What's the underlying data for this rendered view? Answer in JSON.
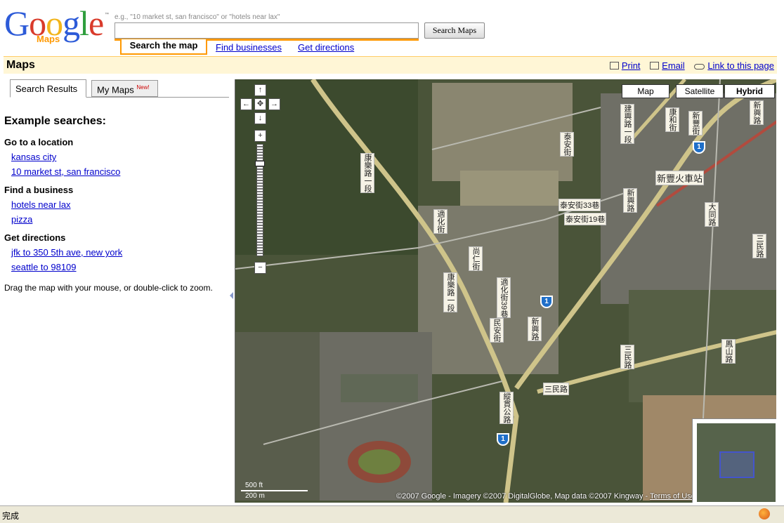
{
  "logo": {
    "text": "Google",
    "product": "Maps",
    "tm": "™"
  },
  "search": {
    "hint": "e.g., \"10 market st, san francisco\" or \"hotels near lax\"",
    "value": "",
    "button": "Search Maps"
  },
  "nav_tabs": [
    {
      "label": "Search the map",
      "active": true
    },
    {
      "label": "Find businesses",
      "active": false
    },
    {
      "label": "Get directions",
      "active": false
    }
  ],
  "titlebar": {
    "title": "Maps",
    "links": [
      {
        "label": "Print",
        "icon": "printer-icon"
      },
      {
        "label": "Email",
        "icon": "envelope-icon"
      },
      {
        "label": "Link to this page",
        "icon": "link-icon"
      }
    ]
  },
  "panel": {
    "tabs": [
      {
        "label": "Search Results"
      },
      {
        "label": "My Maps",
        "badge": "New!"
      }
    ],
    "heading": "Example searches:",
    "groups": [
      {
        "title": "Go to a location",
        "items": [
          "kansas city",
          "10 market st, san francisco"
        ]
      },
      {
        "title": "Find a business",
        "items": [
          "hotels near lax",
          "pizza"
        ]
      },
      {
        "title": "Get directions",
        "items": [
          "jfk to 350 5th ave, new york",
          "seattle to 98109"
        ]
      }
    ],
    "hint": "Drag the map with your mouse, or double-click to zoom."
  },
  "map": {
    "types": [
      "Map",
      "Satellite",
      "Hybrid"
    ],
    "selected_type": "Hybrid",
    "scale": {
      "top": "500 ft",
      "bottom": "200 m"
    },
    "copyright": "©2007 Google - Imagery ©2007 DigitalGlobe, Map data ©2007 Kingway -",
    "terms": "Terms of Use",
    "labels": {
      "station": "新豐火車站",
      "r1": "康樂路一段",
      "r2": "康樂路一段",
      "r3": "建興路一段",
      "r4": "新興路",
      "r5": "新興路",
      "r6": "三民路",
      "r7": "三民路",
      "r8": "泰安街33巷",
      "r9": "泰安街19巷",
      "r10": "泰安街",
      "r11": "適化街",
      "r12": "適化街39巷",
      "r13": "民安街",
      "r14": "尚仁街",
      "r15": "縱貫公路",
      "r16": "大同路",
      "r17": "三民路",
      "r18": "鳳山路",
      "r19": "康和街",
      "r20": "新豐街",
      "r21": "新興路"
    },
    "shield": "1",
    "zoom_level_fraction": 0.84
  },
  "status": {
    "text": "完成"
  },
  "colors": {
    "accent": "#ff9900",
    "link": "#0000cc",
    "titlebar_bg": "#fff6d6"
  }
}
